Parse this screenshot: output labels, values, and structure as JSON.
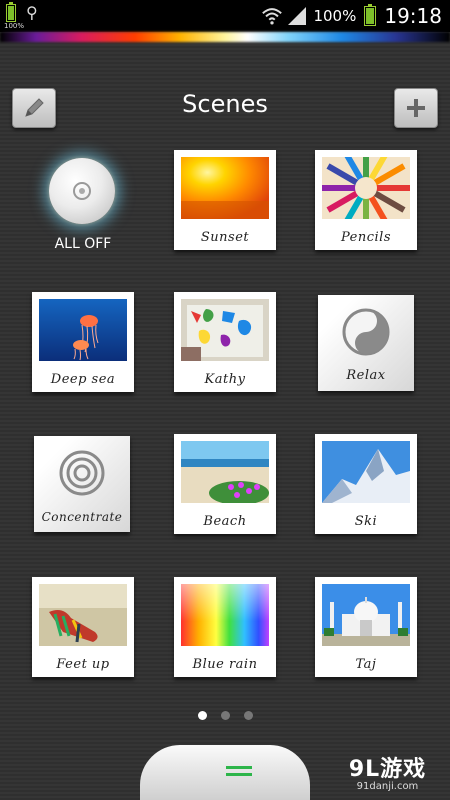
{
  "status_bar": {
    "battery_small_percent": "100%",
    "signal_percent": "100%",
    "time": "19:18",
    "icons": [
      "battery-icon",
      "usb-icon",
      "wifi-icon",
      "signal-icon",
      "battery-icon"
    ]
  },
  "header": {
    "title": "Scenes",
    "edit_icon": "pencil-icon",
    "add_icon": "plus-icon"
  },
  "scenes": [
    {
      "label": "ALL OFF",
      "type": "power"
    },
    {
      "label": "Sunset",
      "type": "photo"
    },
    {
      "label": "Pencils",
      "type": "photo"
    },
    {
      "label": "Deep sea",
      "type": "photo"
    },
    {
      "label": "Kathy",
      "type": "photo"
    },
    {
      "label": "Relax",
      "type": "icon",
      "icon": "yin-yang-icon"
    },
    {
      "label": "Concentrate",
      "type": "icon",
      "icon": "concentric-circles-icon"
    },
    {
      "label": "Beach",
      "type": "photo"
    },
    {
      "label": "Ski",
      "type": "photo"
    },
    {
      "label": "Feet up",
      "type": "photo"
    },
    {
      "label": "Blue rain",
      "type": "photo"
    },
    {
      "label": "Taj",
      "type": "photo"
    }
  ],
  "pager": {
    "pages": 3,
    "current": 1
  },
  "watermark": {
    "logo": "9L游戏",
    "url": "91danji.com"
  },
  "colors": {
    "accent_green": "#2db54a",
    "background": "#333333"
  }
}
